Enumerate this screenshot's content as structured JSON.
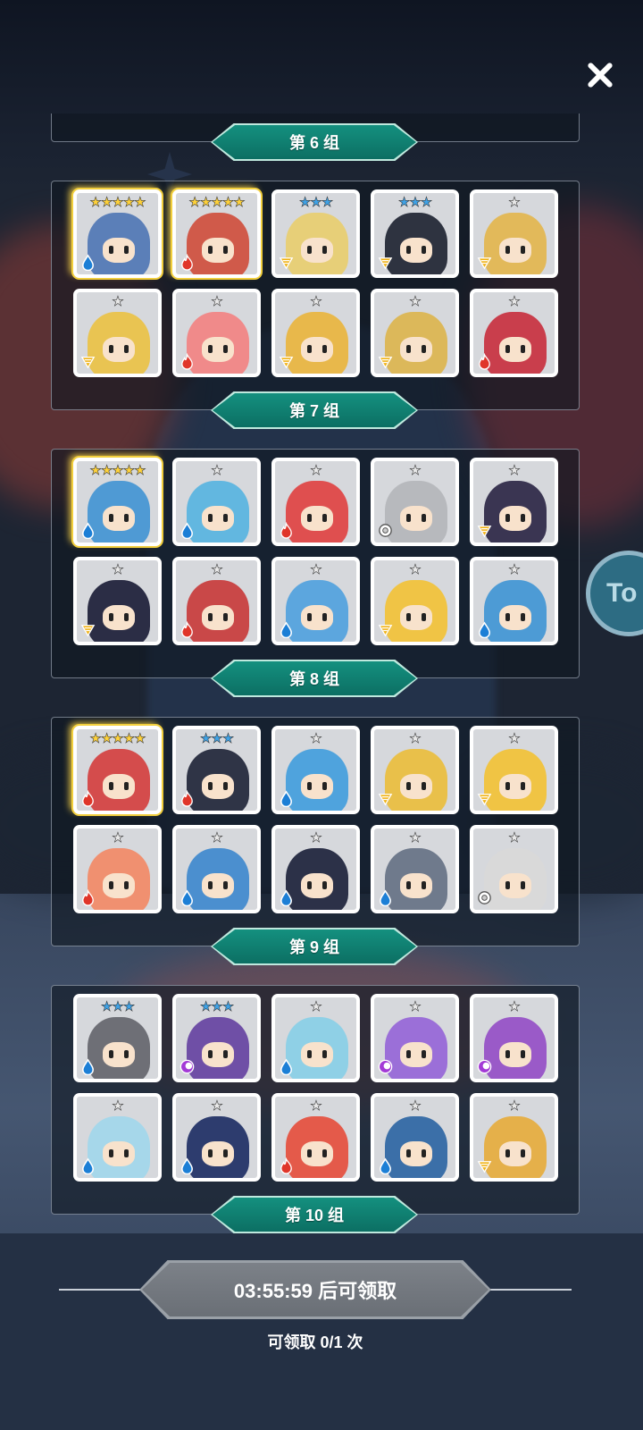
{
  "close_icon": "close-icon",
  "side_button_text": "To",
  "groups": [
    {
      "label": "第 6 组",
      "heroes": [
        {
          "stars": 5,
          "star_color": "gold",
          "element": "water",
          "frame": "gold",
          "color": "#5b7fb8"
        },
        {
          "stars": 5,
          "star_color": "gold",
          "element": "fire",
          "frame": "gold",
          "color": "#d05a4a"
        },
        {
          "stars": 3,
          "star_color": "blue",
          "element": "wind",
          "frame": "normal",
          "color": "#e7cf78"
        },
        {
          "stars": 3,
          "star_color": "blue",
          "element": "wind",
          "frame": "normal",
          "color": "#2e3340"
        },
        {
          "stars": 1,
          "star_color": "white",
          "element": "wind",
          "frame": "normal",
          "color": "#e2b95a"
        },
        {
          "stars": 1,
          "star_color": "white",
          "element": "wind",
          "frame": "normal",
          "color": "#e9c452"
        },
        {
          "stars": 1,
          "star_color": "white",
          "element": "fire",
          "frame": "normal",
          "color": "#f08a8a"
        },
        {
          "stars": 1,
          "star_color": "white",
          "element": "wind",
          "frame": "normal",
          "color": "#e8b84b"
        },
        {
          "stars": 1,
          "star_color": "white",
          "element": "wind",
          "frame": "normal",
          "color": "#dcb85a"
        },
        {
          "stars": 1,
          "star_color": "white",
          "element": "fire",
          "frame": "normal",
          "color": "#c93e4c"
        }
      ]
    },
    {
      "label": "第 7 组",
      "heroes": [
        {
          "stars": 5,
          "star_color": "gold",
          "element": "water",
          "frame": "gold",
          "color": "#4f9ad4"
        },
        {
          "stars": 1,
          "star_color": "white",
          "element": "water",
          "frame": "normal",
          "color": "#62b7e0"
        },
        {
          "stars": 1,
          "star_color": "white",
          "element": "fire",
          "frame": "normal",
          "color": "#df4f4f"
        },
        {
          "stars": 1,
          "star_color": "white",
          "element": "light",
          "frame": "normal",
          "color": "#b7b9bd"
        },
        {
          "stars": 1,
          "star_color": "white",
          "element": "wind",
          "frame": "normal",
          "color": "#3a3552"
        },
        {
          "stars": 1,
          "star_color": "white",
          "element": "wind",
          "frame": "normal",
          "color": "#2b2d45"
        },
        {
          "stars": 1,
          "star_color": "white",
          "element": "fire",
          "frame": "normal",
          "color": "#c94848"
        },
        {
          "stars": 1,
          "star_color": "white",
          "element": "water",
          "frame": "normal",
          "color": "#5ca6de"
        },
        {
          "stars": 1,
          "star_color": "white",
          "element": "wind",
          "frame": "normal",
          "color": "#f0c445"
        },
        {
          "stars": 1,
          "star_color": "white",
          "element": "water",
          "frame": "normal",
          "color": "#4d9bd5"
        }
      ]
    },
    {
      "label": "第 8 组",
      "heroes": [
        {
          "stars": 5,
          "star_color": "gold",
          "element": "fire",
          "frame": "gold",
          "color": "#d44c4c"
        },
        {
          "stars": 3,
          "star_color": "blue",
          "element": "fire",
          "frame": "normal",
          "color": "#2f3446"
        },
        {
          "stars": 1,
          "star_color": "white",
          "element": "water",
          "frame": "normal",
          "color": "#4fa3dd"
        },
        {
          "stars": 1,
          "star_color": "white",
          "element": "wind",
          "frame": "normal",
          "color": "#e9c04a"
        },
        {
          "stars": 1,
          "star_color": "white",
          "element": "wind",
          "frame": "normal",
          "color": "#f0c444"
        },
        {
          "stars": 1,
          "star_color": "white",
          "element": "fire",
          "frame": "normal",
          "color": "#f09070"
        },
        {
          "stars": 1,
          "star_color": "white",
          "element": "water",
          "frame": "normal",
          "color": "#4b8fcf"
        },
        {
          "stars": 1,
          "star_color": "white",
          "element": "water",
          "frame": "normal",
          "color": "#2c3148"
        },
        {
          "stars": 1,
          "star_color": "white",
          "element": "water",
          "frame": "normal",
          "color": "#6f7a8c"
        },
        {
          "stars": 1,
          "star_color": "white",
          "element": "light",
          "frame": "normal",
          "color": "#d9d9d9"
        }
      ]
    },
    {
      "label": "第 9 组",
      "heroes": [
        {
          "stars": 3,
          "star_color": "blue",
          "element": "water",
          "frame": "normal",
          "color": "#6e6f76"
        },
        {
          "stars": 3,
          "star_color": "blue",
          "element": "dark",
          "frame": "normal",
          "color": "#6f4fa6"
        },
        {
          "stars": 1,
          "star_color": "white",
          "element": "water",
          "frame": "normal",
          "color": "#8fd0e6"
        },
        {
          "stars": 1,
          "star_color": "white",
          "element": "dark",
          "frame": "normal",
          "color": "#9b6fd8"
        },
        {
          "stars": 1,
          "star_color": "white",
          "element": "dark",
          "frame": "normal",
          "color": "#9a5ac8"
        },
        {
          "stars": 1,
          "star_color": "white",
          "element": "water",
          "frame": "normal",
          "color": "#a6d7ea"
        },
        {
          "stars": 1,
          "star_color": "white",
          "element": "water",
          "frame": "normal",
          "color": "#2d3c6e"
        },
        {
          "stars": 1,
          "star_color": "white",
          "element": "fire",
          "frame": "normal",
          "color": "#e45a4a"
        },
        {
          "stars": 1,
          "star_color": "white",
          "element": "water",
          "frame": "normal",
          "color": "#3b6fa8"
        },
        {
          "stars": 1,
          "star_color": "white",
          "element": "wind",
          "frame": "normal",
          "color": "#e5b04a"
        }
      ]
    }
  ],
  "last_group_label": "第 10 组",
  "claim": {
    "button_text": "03:55:59 后可领取",
    "count_text": "可领取 0/1 次"
  },
  "colors": {
    "banner": "#0f7f71",
    "gold_star": "#ffd23a",
    "blue_star": "#3fa2e6"
  }
}
